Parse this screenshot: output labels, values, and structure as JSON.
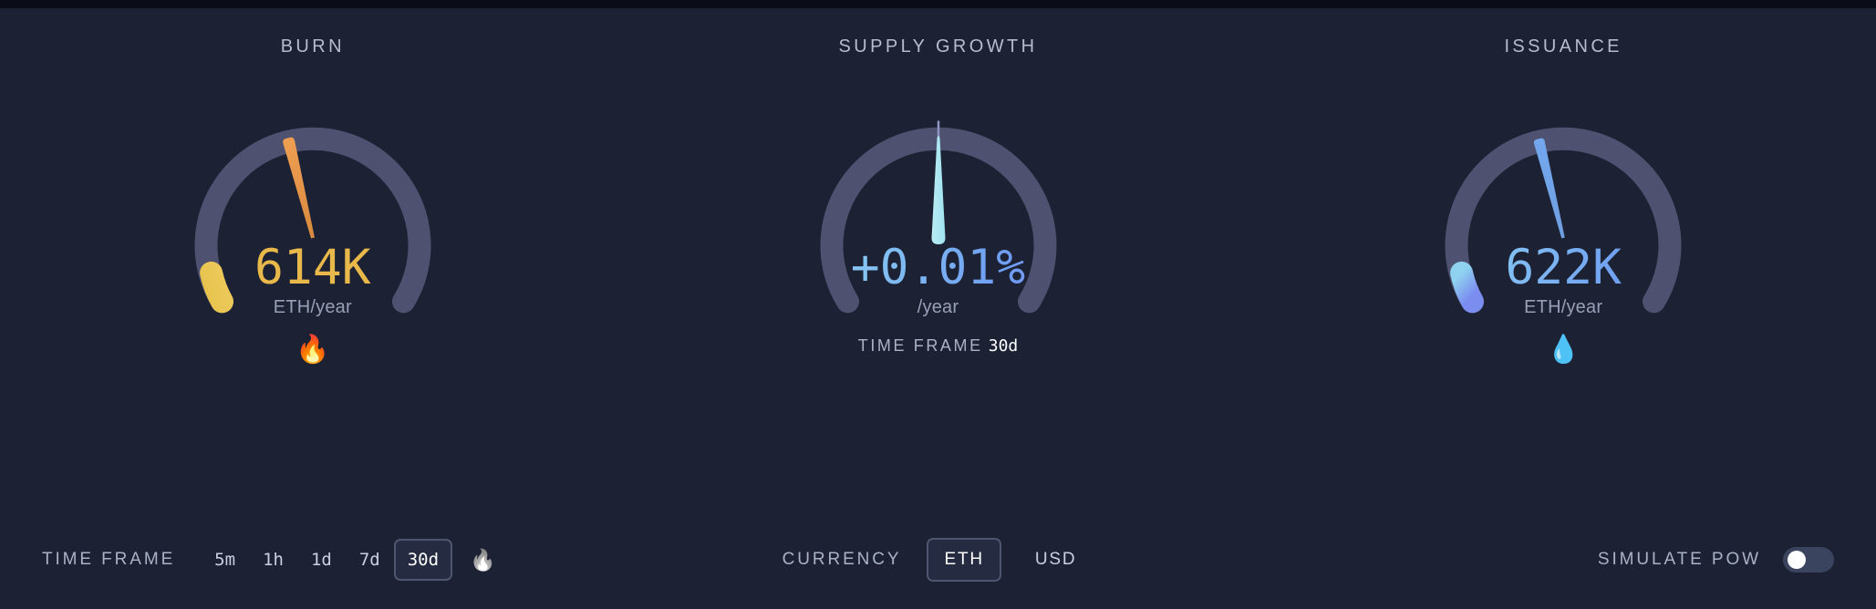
{
  "theme": {
    "background": "#1c2233",
    "track": "#4e5270",
    "burn_accent": "#e8b84b",
    "burn_needle": "#e8964a",
    "growth_accent": "#9fe3f0",
    "issuance_accent_start": "#8fd2f0",
    "issuance_accent_end": "#7b8ef0",
    "label_color": "#aab2c6"
  },
  "panels": [
    {
      "title": "BURN",
      "value": "614K",
      "unit": "ETH/year",
      "emoji": "🔥",
      "emoji_name": "fire-emoji"
    },
    {
      "title": "SUPPLY GROWTH",
      "value": "+0.01%",
      "unit": "/year",
      "timeframe_label": "TIME FRAME",
      "timeframe_value": "30d"
    },
    {
      "title": "ISSUANCE",
      "value": "622K",
      "unit": "ETH/year",
      "emoji": "💧",
      "emoji_name": "droplet-emoji"
    }
  ],
  "controls": {
    "timeframe": {
      "label": "TIME FRAME",
      "options": [
        "5m",
        "1h",
        "1d",
        "7d",
        "30d"
      ],
      "selected": "30d",
      "trailing_emoji": "🔥"
    },
    "currency": {
      "label": "CURRENCY",
      "options": [
        "ETH",
        "USD"
      ],
      "selected": "ETH"
    },
    "simulate_pow": {
      "label": "SIMULATE PoW",
      "enabled": false
    }
  },
  "chart_data": [
    {
      "type": "gauge",
      "title": "BURN",
      "value": 614000,
      "display_value": "614K",
      "unit": "ETH/year",
      "min": 0,
      "max": 4000000,
      "needle_angle_deg": -104,
      "progress_fraction": 0.05,
      "arc_start_deg": -125,
      "arc_end_deg": 125,
      "color": "#e8b84b"
    },
    {
      "type": "gauge",
      "title": "SUPPLY GROWTH",
      "value": 0.01,
      "display_value": "+0.01%",
      "unit": "/year",
      "min": -5,
      "max": 5,
      "needle_angle_deg": 0,
      "progress_fraction": 0,
      "arc_start_deg": -125,
      "arc_end_deg": 125,
      "tick_at_deg": 0,
      "color": "#9fe3f0"
    },
    {
      "type": "gauge",
      "title": "ISSUANCE",
      "value": 622000,
      "display_value": "622K",
      "unit": "ETH/year",
      "min": 0,
      "max": 4000000,
      "needle_angle_deg": -104,
      "progress_fraction": 0.05,
      "arc_start_deg": -125,
      "arc_end_deg": 125,
      "color": "#8fd2f0"
    }
  ]
}
